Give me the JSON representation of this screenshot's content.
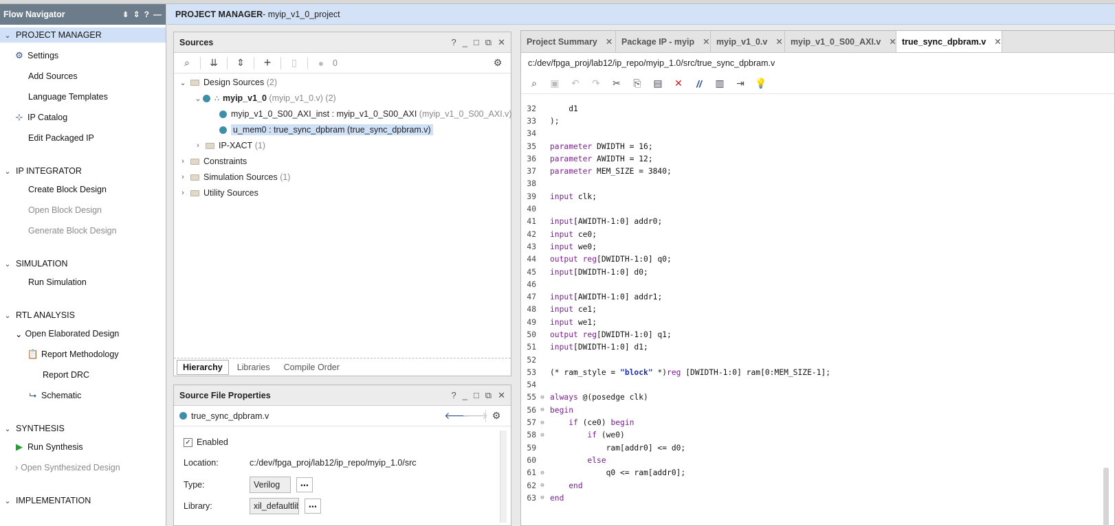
{
  "flow_navigator": {
    "title": "Flow Navigator",
    "items": [
      {
        "type": "section",
        "label": "PROJECT MANAGER",
        "active": true
      },
      {
        "type": "item",
        "label": "Settings",
        "icon": "gear-icon"
      },
      {
        "type": "item",
        "label": "Add Sources"
      },
      {
        "type": "item",
        "label": "Language Templates"
      },
      {
        "type": "item",
        "label": "IP Catalog",
        "icon": "ip-catalog-icon"
      },
      {
        "type": "item",
        "label": "Edit Packaged IP"
      },
      {
        "type": "section",
        "label": "IP INTEGRATOR"
      },
      {
        "type": "item",
        "label": "Create Block Design"
      },
      {
        "type": "item",
        "label": "Open Block Design",
        "disabled": true
      },
      {
        "type": "item",
        "label": "Generate Block Design",
        "disabled": true
      },
      {
        "type": "section",
        "label": "SIMULATION"
      },
      {
        "type": "item",
        "label": "Run Simulation"
      },
      {
        "type": "section",
        "label": "RTL ANALYSIS"
      },
      {
        "type": "sub",
        "label": "Open Elaborated Design"
      },
      {
        "type": "item",
        "label": "Report Methodology",
        "icon": "report-icon"
      },
      {
        "type": "item",
        "label": "Report DRC"
      },
      {
        "type": "item",
        "label": "Schematic",
        "icon": "schematic-icon",
        "link": true
      },
      {
        "type": "section",
        "label": "SYNTHESIS"
      },
      {
        "type": "item",
        "label": "Run Synthesis",
        "icon": "play-icon"
      },
      {
        "type": "sub",
        "label": "Open Synthesized Design",
        "disabled": true
      },
      {
        "type": "section",
        "label": "IMPLEMENTATION"
      }
    ]
  },
  "header": {
    "prefix": "PROJECT MANAGER",
    "suffix": " - myip_v1_0_project"
  },
  "sources": {
    "title": "Sources",
    "count": "0",
    "tree": {
      "design_sources": "Design Sources",
      "design_sources_count": "(2)",
      "top": "myip_v1_0",
      "top_file": "(myip_v1_0.v)",
      "top_count": "(2)",
      "child1": "myip_v1_0_S00_AXI_inst : myip_v1_0_S00_AXI",
      "child1_file": "(myip_v1_0_S00_AXI.v)",
      "child2": "u_mem0 : true_sync_dpbram (true_sync_dpbram.v)",
      "ipxact": "IP-XACT",
      "ipxact_count": "(1)",
      "constraints": "Constraints",
      "sim": "Simulation Sources",
      "sim_count": "(1)",
      "util": "Utility Sources"
    },
    "tabs": [
      "Hierarchy",
      "Libraries",
      "Compile Order"
    ]
  },
  "properties": {
    "title": "Source File Properties",
    "file": "true_sync_dpbram.v",
    "enabled_label": "Enabled",
    "location_label": "Location:",
    "location": "c:/dev/fpga_proj/lab12/ip_repo/myip_1.0/src",
    "type_label": "Type:",
    "type": "Verilog",
    "library_label": "Library:",
    "library": "xil_defaultlib"
  },
  "editor": {
    "tabs": [
      "Project Summary",
      "Package IP - myip",
      "myip_v1_0.v",
      "myip_v1_0_S00_AXI.v",
      "true_sync_dpbram.v"
    ],
    "path": "c:/dev/fpga_proj/lab12/ip_repo/myip_1.0/src/true_sync_dpbram.v",
    "lines": [
      {
        "n": "32",
        "t": "    d1"
      },
      {
        "n": "33",
        "t": ");"
      },
      {
        "n": "34",
        "t": ""
      },
      {
        "n": "35",
        "k": "parameter",
        "t": " DWIDTH = 16;"
      },
      {
        "n": "36",
        "k": "parameter",
        "t": " AWIDTH = 12;"
      },
      {
        "n": "37",
        "k": "parameter",
        "t": " MEM_SIZE = 3840;"
      },
      {
        "n": "38",
        "t": ""
      },
      {
        "n": "39",
        "k": "input",
        "t": " clk;"
      },
      {
        "n": "40",
        "t": ""
      },
      {
        "n": "41",
        "k": "input",
        "t": "[AWIDTH-1:0] addr0;"
      },
      {
        "n": "42",
        "k": "input",
        "t": " ce0;"
      },
      {
        "n": "43",
        "k": "input",
        "t": " we0;"
      },
      {
        "n": "44",
        "k": "output",
        "k2": "reg",
        "t": "[DWIDTH-1:0] q0;"
      },
      {
        "n": "45",
        "k": "input",
        "t": "[DWIDTH-1:0] d0;"
      },
      {
        "n": "46",
        "t": ""
      },
      {
        "n": "47",
        "k": "input",
        "t": "[AWIDTH-1:0] addr1;"
      },
      {
        "n": "48",
        "k": "input",
        "t": " ce1;"
      },
      {
        "n": "49",
        "k": "input",
        "t": " we1;"
      },
      {
        "n": "50",
        "k": "output",
        "k2": "reg",
        "t": "[DWIDTH-1:0] q1;"
      },
      {
        "n": "51",
        "k": "input",
        "t": "[DWIDTH-1:0] d1;"
      },
      {
        "n": "52",
        "t": ""
      },
      {
        "n": "53",
        "special": "ramstyle",
        "t": "(* ram_style = "
      },
      {
        "n": "54",
        "t": ""
      },
      {
        "n": "55",
        "fold": true,
        "k": "always",
        "t": " @(posedge clk)"
      },
      {
        "n": "56",
        "fold": true,
        "k": "begin",
        "t": ""
      },
      {
        "n": "57",
        "fold": true,
        "ind": "    ",
        "k": "if",
        "t": " (ce0) ",
        "k3": "begin"
      },
      {
        "n": "58",
        "fold": true,
        "ind": "        ",
        "k": "if",
        "t": " (we0)"
      },
      {
        "n": "59",
        "t": "            ram[addr0] <= d0;"
      },
      {
        "n": "60",
        "ind": "        ",
        "k": "else",
        "t": ""
      },
      {
        "n": "61",
        "fold": true,
        "t": "            q0 <= ram[addr0];"
      },
      {
        "n": "62",
        "fold": true,
        "ind": "    ",
        "k": "end",
        "t": ""
      },
      {
        "n": "63",
        "fold": true,
        "k": "end",
        "t": ""
      }
    ],
    "ramstyle_str": "\"block\"",
    "ramstyle_mid": " *)",
    "ramstyle_kw": "reg",
    "ramstyle_tail": " [DWIDTH-1:0] ram[0:MEM_SIZE-1];"
  }
}
